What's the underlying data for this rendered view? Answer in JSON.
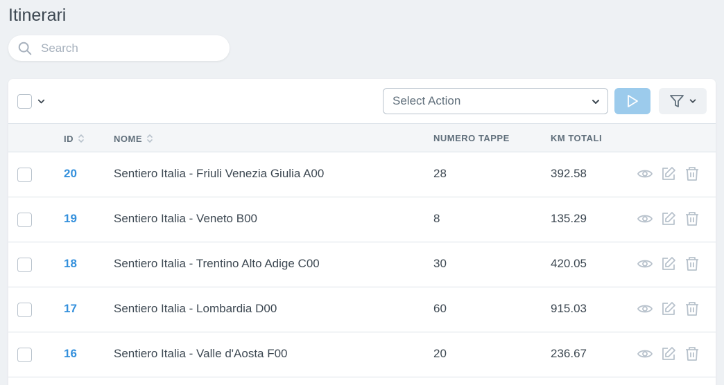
{
  "header": {
    "title": "Itinerari"
  },
  "search": {
    "placeholder": "Search",
    "value": ""
  },
  "toolbar": {
    "select_action": "Select Action"
  },
  "table": {
    "columns": {
      "id": "ID",
      "nome": "NOME",
      "tappe": "NUMERO TAPPE",
      "km": "KM TOTALI"
    },
    "rows": [
      {
        "id": "20",
        "nome": "Sentiero Italia - Friuli Venezia Giulia A00",
        "tappe": "28",
        "km": "392.58"
      },
      {
        "id": "19",
        "nome": "Sentiero Italia - Veneto B00",
        "tappe": "8",
        "km": "135.29"
      },
      {
        "id": "18",
        "nome": "Sentiero Italia - Trentino Alto Adige C00",
        "tappe": "30",
        "km": "420.05"
      },
      {
        "id": "17",
        "nome": "Sentiero Italia - Lombardia D00",
        "tappe": "60",
        "km": "915.03"
      },
      {
        "id": "16",
        "nome": "Sentiero Italia - Valle d'Aosta F00",
        "tappe": "20",
        "km": "236.67"
      }
    ]
  },
  "icons": {
    "search": "search-icon",
    "chevron": "chevron-down-icon",
    "run": "play-icon",
    "filter": "filter-icon",
    "view": "eye-icon",
    "edit": "edit-icon",
    "delete": "trash-icon"
  },
  "colors": {
    "link": "#3490dc",
    "run_button": "#9ccbec",
    "background": "#eef1f4"
  }
}
